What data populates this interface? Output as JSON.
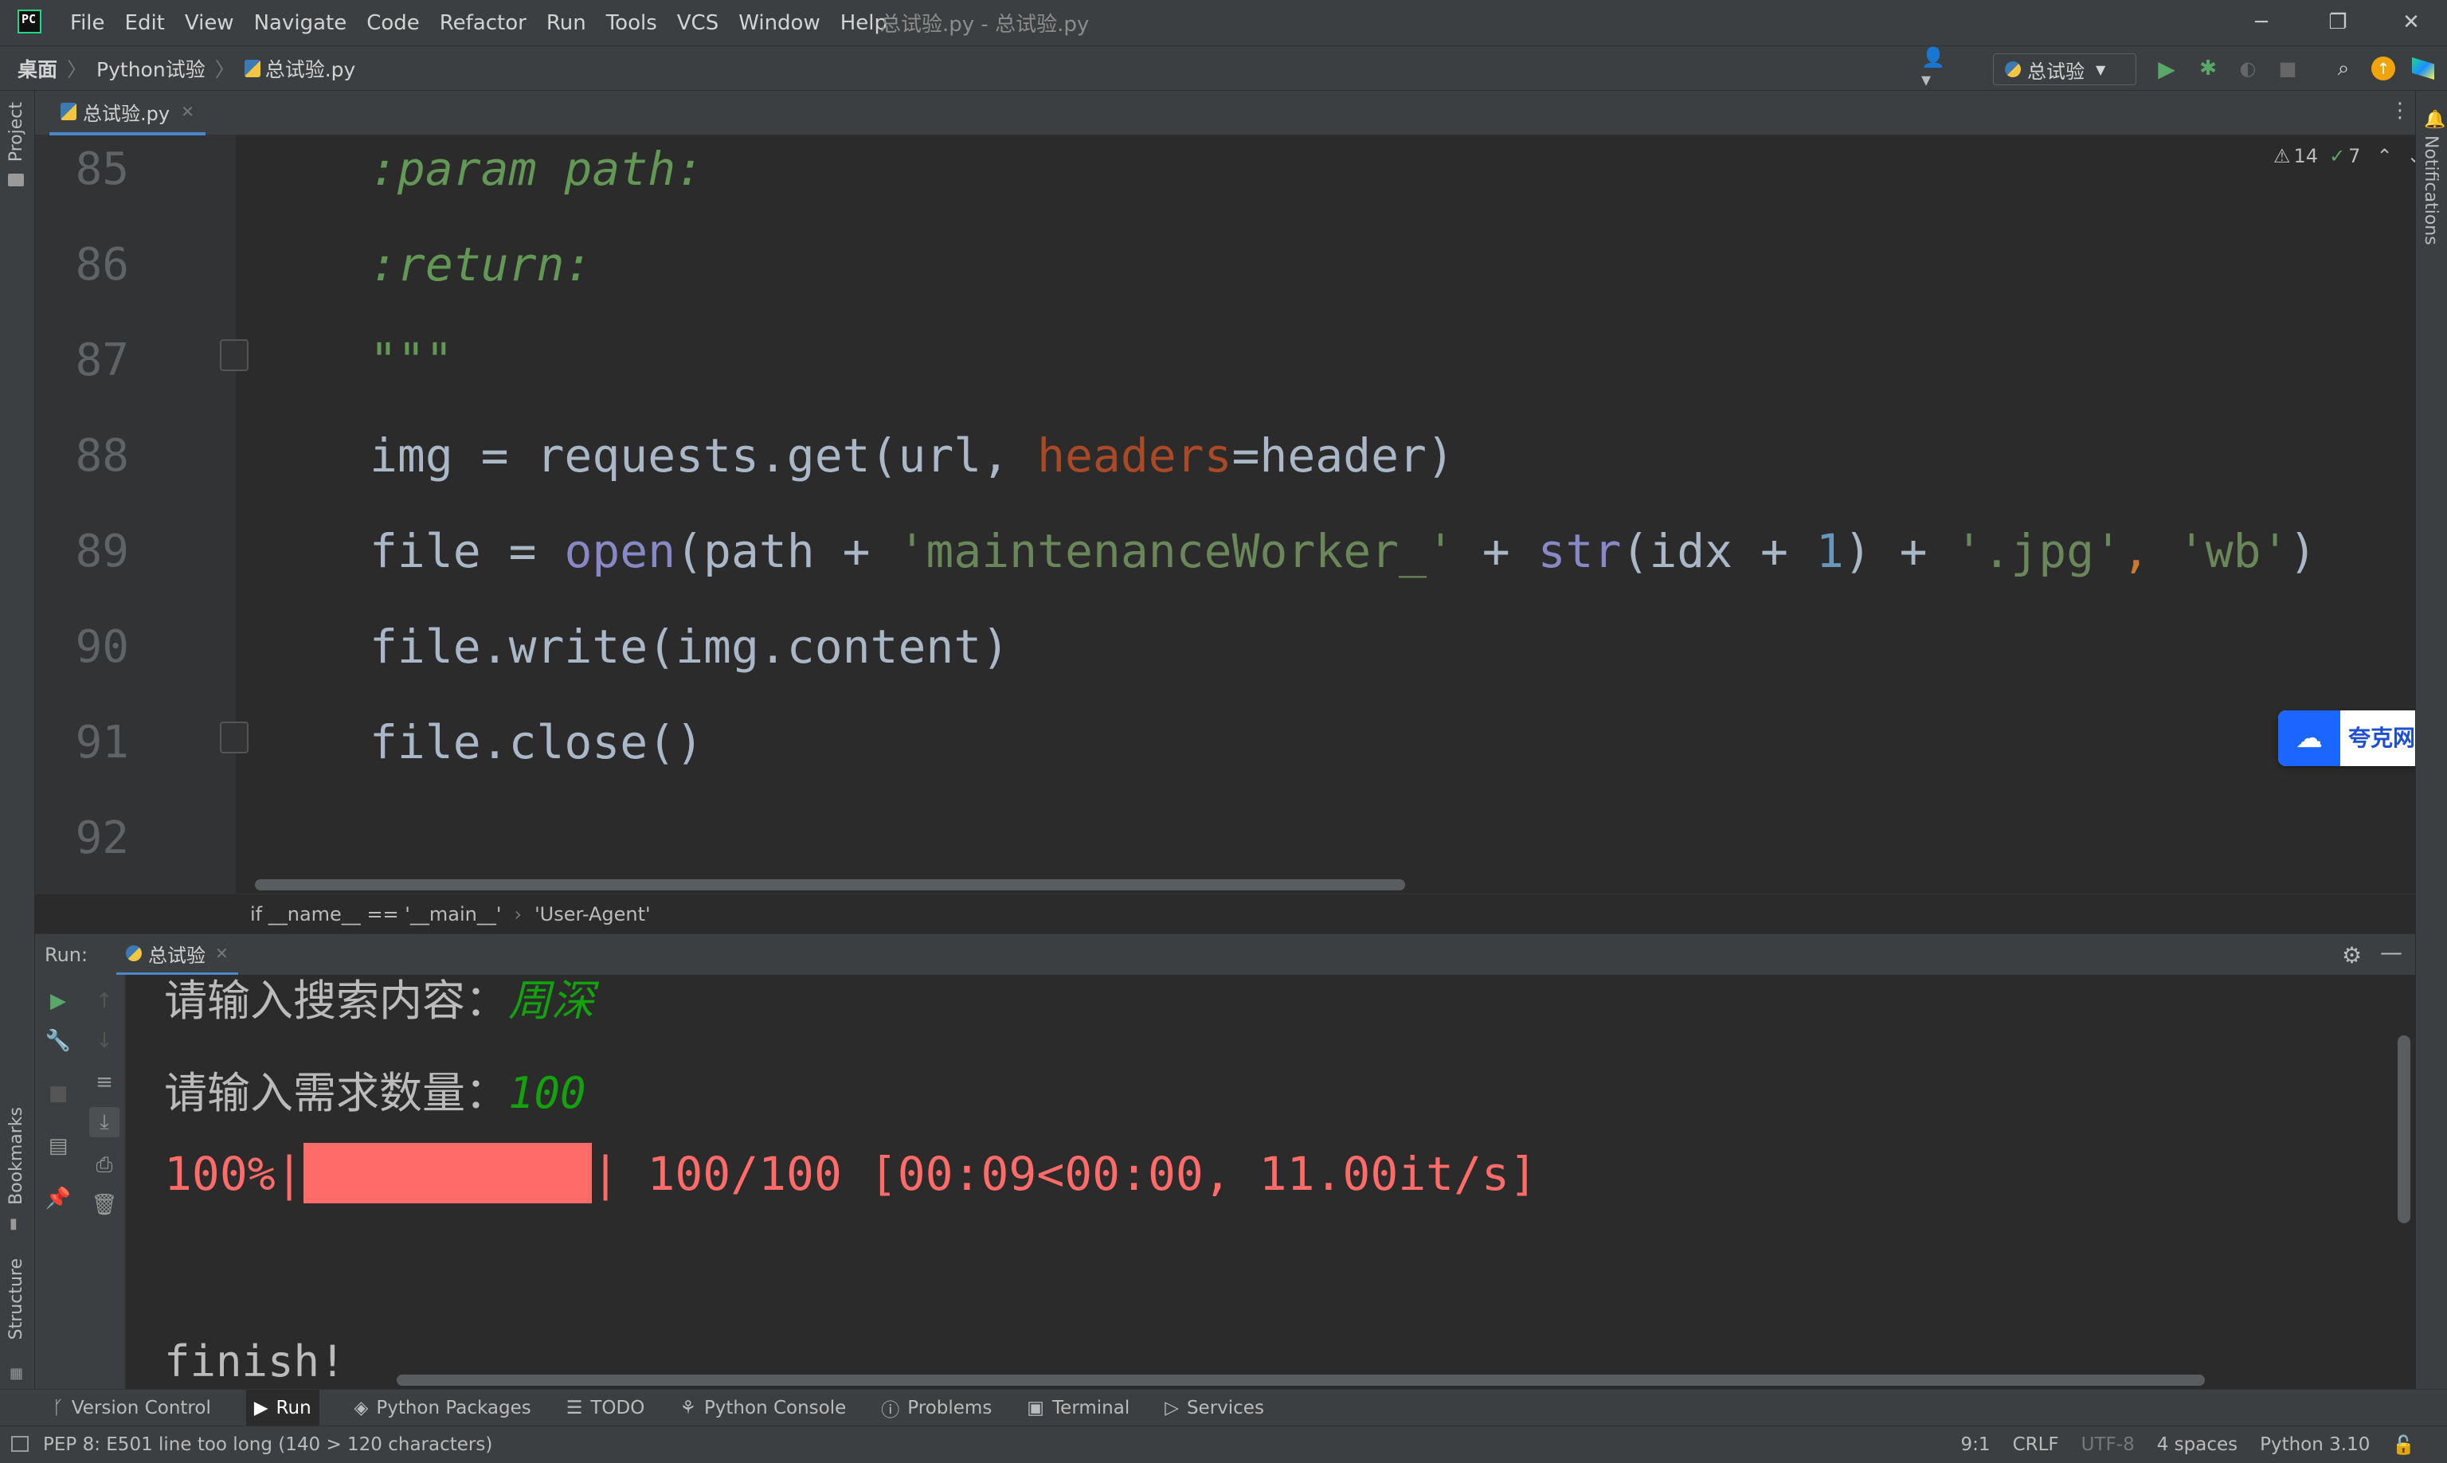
{
  "window": {
    "title": "总试验.py - 总试验.py",
    "menu": [
      "File",
      "Edit",
      "View",
      "Navigate",
      "Code",
      "Refactor",
      "Run",
      "Tools",
      "VCS",
      "Window",
      "Help"
    ],
    "controls": {
      "minimize": "─",
      "restore": "❐",
      "close": "✕"
    }
  },
  "navbar": {
    "breadcrumb": [
      "桌面",
      "Python试验",
      "总试验.py"
    ],
    "run_config": "总试验"
  },
  "left_strip": {
    "project": "Project",
    "bookmarks": "Bookmarks",
    "structure": "Structure"
  },
  "right_strip": {
    "notifications": "Notifications"
  },
  "editor": {
    "tab_label": "总试验.py",
    "inspections": {
      "warnings": "14",
      "checks": "7"
    },
    "lines": [
      {
        "num": "85"
      },
      {
        "num": "86"
      },
      {
        "num": "87"
      },
      {
        "num": "88"
      },
      {
        "num": "89"
      },
      {
        "num": "90"
      },
      {
        "num": "91"
      },
      {
        "num": "92"
      }
    ],
    "code": {
      "l85": ":param path:",
      "l86": ":return:",
      "l87": "\"\"\"",
      "l88": [
        "img = requests.get(url, ",
        "headers",
        "=header)"
      ],
      "l89": [
        "file = ",
        "open",
        "(path + ",
        "'maintenanceWorker_'",
        " + ",
        "str",
        "(idx + ",
        "1",
        ") + ",
        "'.jpg'",
        ", ",
        "'wb'",
        ")"
      ],
      "l90": "file.write(img.content)",
      "l91": "file.close()"
    },
    "quark_label": "夸克网盘",
    "breadcrumb": [
      "if __name__ == '__main__'",
      "'User-Agent'"
    ]
  },
  "run": {
    "label": "Run:",
    "tab": "总试验",
    "console": {
      "line1_prompt": "请输入搜索内容：",
      "line1_input": "周深",
      "line2_prompt": "请输入需求数量：",
      "line2_input": "100",
      "progress_pct": "100%|",
      "progress_fill": 1.0,
      "progress_rest": "| 100/100 [00:09<00:00, 11.00it/s]",
      "finish": "finish!"
    }
  },
  "tool_tabs": [
    "Version Control",
    "Run",
    "Python Packages",
    "TODO",
    "Python Console",
    "Problems",
    "Terminal",
    "Services"
  ],
  "status": {
    "message": "PEP 8: E501 line too long (140 > 120 characters)",
    "position": "9:1",
    "line_sep": "CRLF",
    "encoding": "UTF-8",
    "indent": "4 spaces",
    "interpreter": "Python 3.10"
  },
  "colors": {
    "accent": "#4a88c7",
    "progress": "#ff6b68",
    "input": "#13a10e"
  }
}
